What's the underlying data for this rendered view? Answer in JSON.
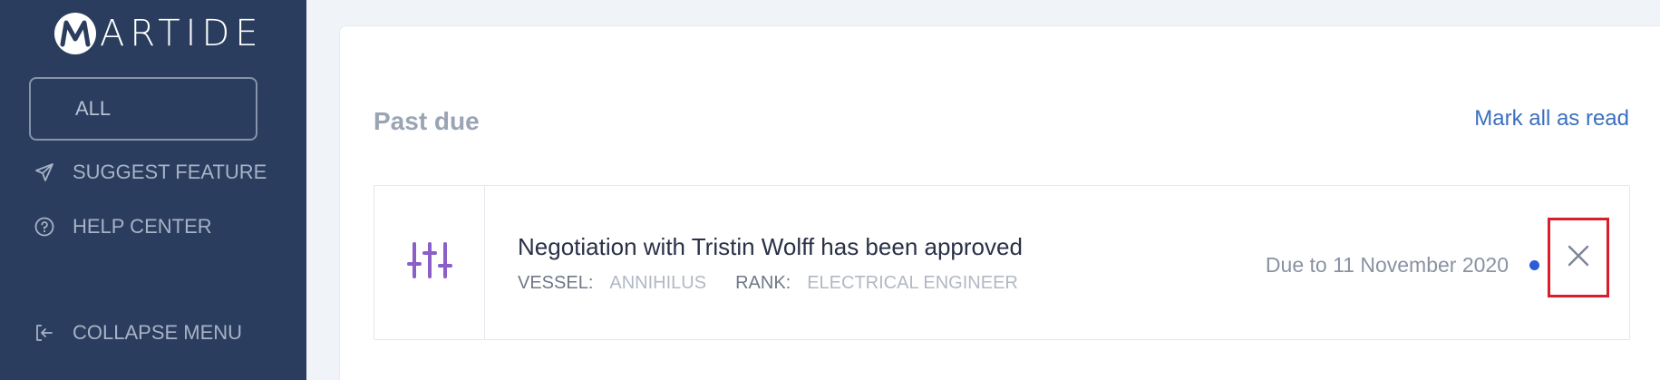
{
  "brand": {
    "logo_letter": "M",
    "logo_text": "ARTIDE"
  },
  "sidebar": {
    "filter_label": "ALL",
    "items": [
      {
        "label": "SUGGEST FEATURE",
        "icon": "send-icon"
      },
      {
        "label": "HELP CENTER",
        "icon": "question-circle-icon"
      },
      {
        "label": "COLLAPSE MENU",
        "icon": "collapse-icon"
      }
    ]
  },
  "main": {
    "section_title": "Past due",
    "mark_all_label": "Mark all as read",
    "notifications": [
      {
        "icon": "sliders-icon",
        "title": "Negotiation with Tristin Wolff has been approved",
        "vessel_label": "VESSEL:",
        "vessel_value": "ANNIHILUS",
        "rank_label": "RANK:",
        "rank_value": "ELECTRICAL ENGINEER",
        "due": "Due to 11 November 2020",
        "unread": true
      }
    ]
  },
  "colors": {
    "sidebar_bg": "#2a3d5e",
    "page_bg": "#f0f3f8",
    "accent_link": "#3a6fbf",
    "icon_purple": "#8a5fc7",
    "unread_dot": "#2e5cd6",
    "highlight": "#d81e2a"
  }
}
